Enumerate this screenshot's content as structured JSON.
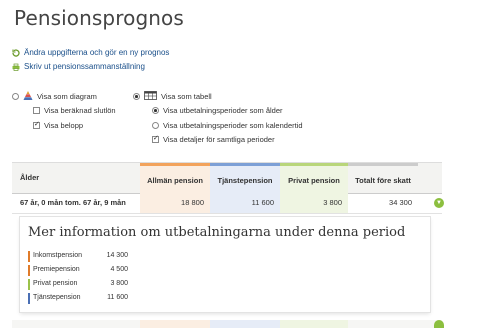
{
  "page_title": "Pensionsprognos",
  "links": {
    "change": "Ändra uppgifterna och gör en ny prognos",
    "print": "Skriv ut pensionssammanställning"
  },
  "view_options": {
    "diagram": "Visa som diagram",
    "table": "Visa som tabell",
    "calc_end": "Visa beräknad slutlön",
    "amount": "Visa belopp",
    "periods_age": "Visa utbetalningsperioder som ålder",
    "periods_calendar": "Visa utbetalningsperioder som kalendertid",
    "details_all": "Visa detaljer för samtliga perioder"
  },
  "table": {
    "headers": {
      "age": "Ålder",
      "general": "Allmän pension",
      "service": "Tjänstepension",
      "private": "Privat pension",
      "total": "Totalt före skatt"
    },
    "row": {
      "period": "67 år, 0 mån tom. 67 år, 9 mån",
      "general": "18 800",
      "service": "11 600",
      "private": "3 800",
      "total": "34 300"
    }
  },
  "details": {
    "title": "Mer information om utbetalningarna under denna period",
    "items": [
      {
        "label": "Inkomstpension",
        "value": "14 300",
        "color": "#e07b2a"
      },
      {
        "label": "Premiepension",
        "value": "4 500",
        "color": "#e07b2a"
      },
      {
        "label": "Privat pension",
        "value": "3 800",
        "color": "#9bc24a"
      },
      {
        "label": "Tjänstepension",
        "value": "11 600",
        "color": "#4a6fb5"
      }
    ]
  },
  "colors": {
    "general": "#f2a35c",
    "service": "#7da0d6",
    "private": "#b9d67a",
    "total": "#cccccc",
    "link": "#1a4f8a"
  }
}
